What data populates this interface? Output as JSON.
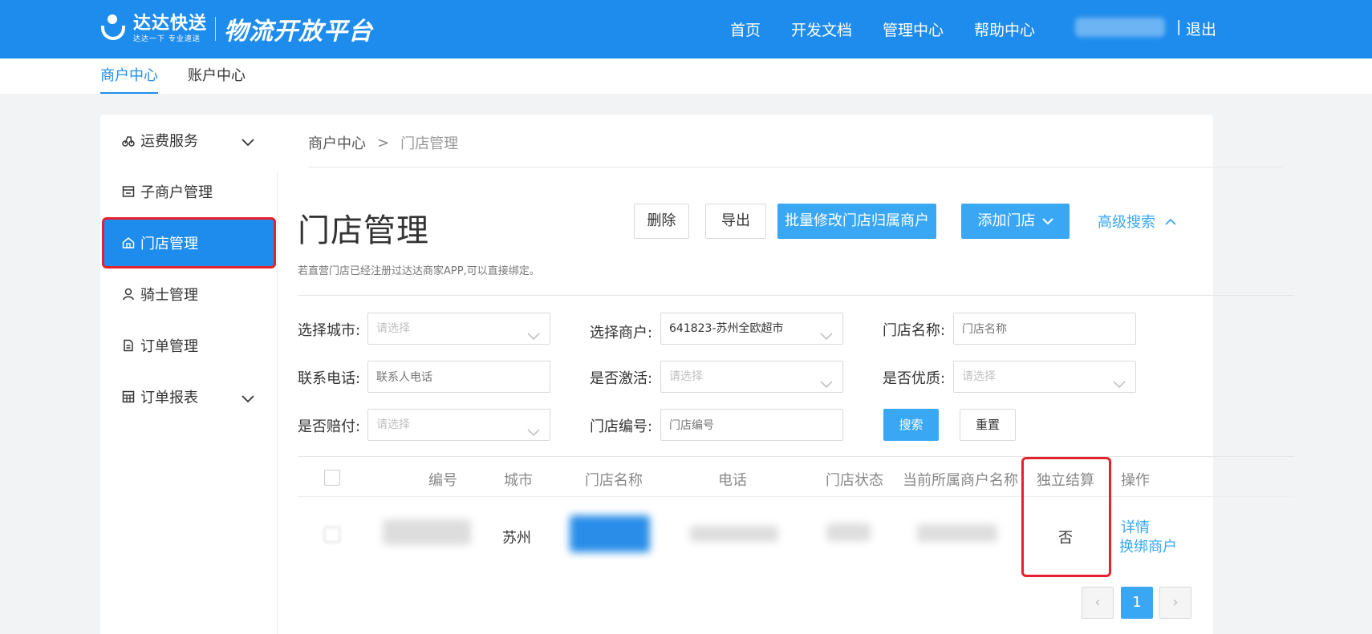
{
  "header": {
    "logo_main": "达达快送",
    "logo_sub": "达达一下 专业速送",
    "platform": "物流开放平台",
    "nav": [
      "首页",
      "开发文档",
      "管理中心",
      "帮助中心"
    ],
    "separator": "|",
    "logout": "退出"
  },
  "subtabs": [
    "商户中心",
    "账户中心"
  ],
  "sidebar": {
    "items": [
      {
        "label": "运费服务",
        "icon": "freight-icon"
      },
      {
        "label": "子商户管理",
        "icon": "store-icon"
      },
      {
        "label": "门店管理",
        "icon": "home-icon"
      },
      {
        "label": "骑士管理",
        "icon": "rider-icon"
      },
      {
        "label": "订单管理",
        "icon": "document-icon"
      },
      {
        "label": "订单报表",
        "icon": "calculator-icon"
      }
    ]
  },
  "breadcrumb": {
    "root": "商户中心",
    "sep": ">",
    "current": "门店管理"
  },
  "page": {
    "title": "门店管理",
    "tip": "若直营门店已经注册过达达商家APP,可以直接绑定。",
    "buttons": {
      "delete": "删除",
      "export": "导出",
      "batch_edit": "批量修改门店归属商户",
      "add_store": "添加门店",
      "advanced": "高级搜索"
    }
  },
  "filters": {
    "city_label": "选择城市:",
    "city_placeholder": "请选择",
    "merchant_label": "选择商户:",
    "merchant_value": "641823-苏州全欧超市",
    "store_name_label": "门店名称:",
    "store_name_placeholder": "门店名称",
    "phone_label": "联系电话:",
    "phone_placeholder": "联系人电话",
    "active_label": "是否激活:",
    "active_placeholder": "请选择",
    "quality_label": "是否优质:",
    "quality_placeholder": "请选择",
    "compensate_label": "是否赔付:",
    "compensate_placeholder": "请选择",
    "store_no_label": "门店编号:",
    "store_no_placeholder": "门店编号",
    "search": "搜索",
    "reset": "重置"
  },
  "table": {
    "headers": [
      "编号",
      "城市",
      "门店名称",
      "电话",
      "门店状态",
      "当前所属商户名称",
      "独立结算",
      "操作"
    ],
    "rows": [
      {
        "city": "苏州",
        "independent": "否",
        "actions": [
          "详情",
          "换绑商户"
        ]
      }
    ]
  },
  "pagination": {
    "prev": "‹",
    "current": "1",
    "next": "›"
  },
  "colors": {
    "brand": "#1e8ced",
    "accent": "#3aa7f4",
    "highlight": "#e5222c"
  }
}
